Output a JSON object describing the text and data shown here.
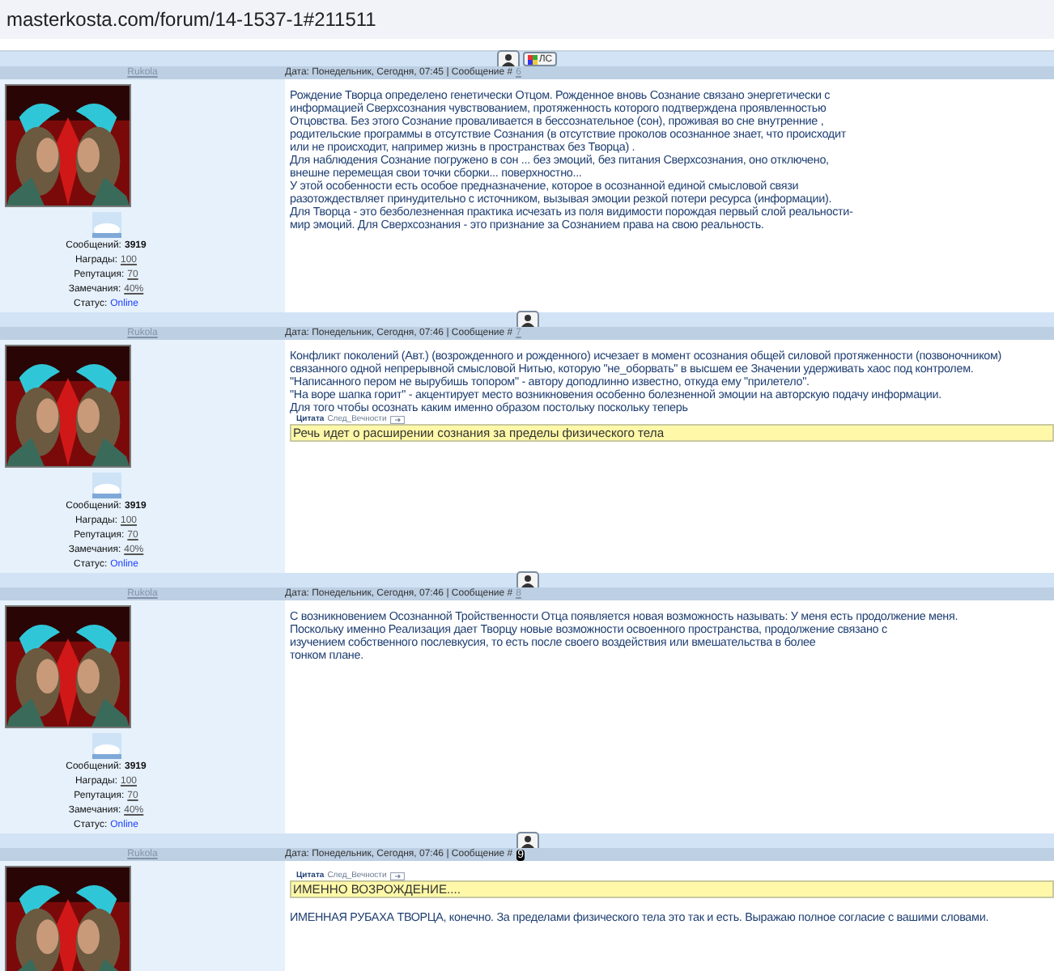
{
  "address_bar": {
    "url": "masterkosta.com/forum/14-1537-1#211511"
  },
  "posts": [
    {
      "buttons": [
        {
          "kind": "profile"
        },
        {
          "kind": "pm",
          "label": "ЛС"
        }
      ],
      "author": "Rukola",
      "date": "Дата: Понедельник, Сегодня, 07:45 | Сообщение #",
      "number": "6",
      "number_highlighted": false,
      "stats": [
        {
          "label": "Сообщений:",
          "value": "3919",
          "kind": "plain"
        },
        {
          "label": "Награды:",
          "value": "100",
          "kind": "link"
        },
        {
          "label": "Репутация:",
          "value": "70",
          "kind": "link"
        },
        {
          "label": "Замечания:",
          "value": "40%",
          "kind": "link"
        },
        {
          "label": "Статус:",
          "value": "Online",
          "kind": "status"
        }
      ],
      "content": [
        {
          "kind": "text",
          "lines": [
            "Рождение Творца определено генетически Отцом. Рожденное вновь Сознание связано энергетически с",
            "информацией Сверхсознания чувствованием, протяженность которого подтверждена проявленностью",
            "Отцовства. Без этого Сознание проваливается в бессознательное (сон), проживая во сне внутренние ,",
            "родительские программы в отсутствие Сознания (в отсутствие проколов осознанное знает, что происходит",
            "или не происходит, например жизнь в пространствах без Творца) .",
            "Для наблюдения Сознание погружено в сон ... без эмоций, без питания Сверхсознания, оно отключено,",
            "внешне перемещая свои точки сборки... поверхностно...",
            "У этой особенности есть особое предназначение, которое в осознанной единой смысловой связи",
            "разотождествляет принудительно с источником, вызывая эмоции резкой потери ресурса (информации).",
            "Для Творца - это безболезненная практика исчезать из поля видимости порождая первый слой реальности-",
            "мир эмоций. Для Сверхсознания - это признание за Сознанием права на свою реальность."
          ]
        }
      ]
    },
    {
      "buttons": [
        {
          "kind": "profile"
        }
      ],
      "author": "Rukola",
      "date": "Дата: Понедельник, Сегодня, 07:46 | Сообщение #",
      "number": "7",
      "number_highlighted": false,
      "stats": [
        {
          "label": "Сообщений:",
          "value": "3919",
          "kind": "plain"
        },
        {
          "label": "Награды:",
          "value": "100",
          "kind": "link"
        },
        {
          "label": "Репутация:",
          "value": "70",
          "kind": "link"
        },
        {
          "label": "Замечания:",
          "value": "40%",
          "kind": "link"
        },
        {
          "label": "Статус:",
          "value": "Online",
          "kind": "status"
        }
      ],
      "content": [
        {
          "kind": "text",
          "lines": [
            "Конфликт поколений (Авт.) (возрожденного и рожденного) исчезает в момент осознания общей силовой протяженности (позвоночником)",
            "связанного одной непрерывной смысловой Нитью, которую \"не_оборвать\" в высшем ее Значении удерживать хаос под контролем.",
            "\"Написанного пером не вырубишь топором\" - автору доподлинно известно, откуда ему \"прилетело\".",
            "\"На воре шапка горит\" - акцентирует место возникновения особенно болезненной эмоции на авторскую подачу информации.",
            "Для того чтобы осознать каким именно образом постольку поскольку теперь"
          ]
        },
        {
          "kind": "quote",
          "caption": "Цитата",
          "author": "След_Вечности",
          "text": "Речь идет о расширении сознания за пределы физического тела"
        }
      ]
    },
    {
      "buttons": [
        {
          "kind": "profile"
        }
      ],
      "author": "Rukola",
      "date": "Дата: Понедельник, Сегодня, 07:46 | Сообщение #",
      "number": "8",
      "number_highlighted": false,
      "stats": [
        {
          "label": "Сообщений:",
          "value": "3919",
          "kind": "plain"
        },
        {
          "label": "Награды:",
          "value": "100",
          "kind": "link"
        },
        {
          "label": "Репутация:",
          "value": "70",
          "kind": "link"
        },
        {
          "label": "Замечания:",
          "value": "40%",
          "kind": "link"
        },
        {
          "label": "Статус:",
          "value": "Online",
          "kind": "status"
        }
      ],
      "content": [
        {
          "kind": "text",
          "lines": [
            "С возникновением Осознанной Тройственности Отца появляется новая возможность называть: У меня есть продолжение меня.",
            "Поскольку именно Реализация дает Творцу новые возможности освоенного пространства, продолжение связано с",
            "изучением собственного послевкусия, то есть после своего воздействия или вмешательства в более",
            "тонком плане."
          ]
        }
      ]
    },
    {
      "buttons": [
        {
          "kind": "profile"
        }
      ],
      "author": "Rukola",
      "date": "Дата: Понедельник, Сегодня, 07:46 | Сообщение #",
      "number": "9",
      "number_highlighted": true,
      "content": [
        {
          "kind": "quote",
          "caption": "Цитата",
          "author": "След_Вечности",
          "text": "ИМЕННО ВОЗРОЖДЕНИЕ...."
        },
        {
          "kind": "text",
          "lines": [
            "ИМЕННАЯ РУБАХА ТВОРЦА, конечно. За пределами физического тела это так и есть. Выражаю полное согласие с вашими словами."
          ]
        }
      ]
    }
  ]
}
